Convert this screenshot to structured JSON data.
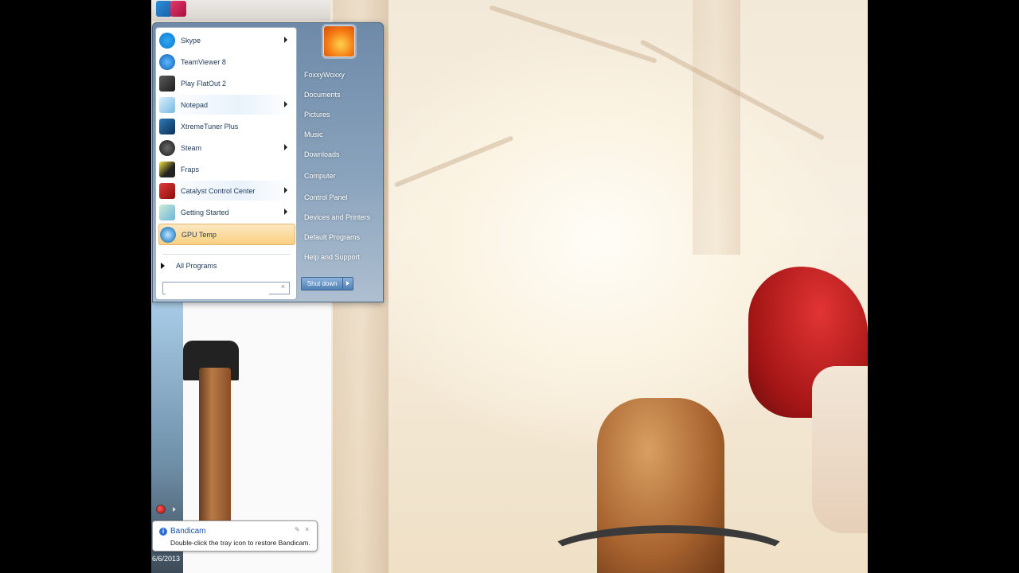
{
  "start_menu": {
    "programs": [
      {
        "label": "Skype",
        "icon": "skype-icon",
        "has_submenu": true
      },
      {
        "label": "TeamViewer 8",
        "icon": "teamviewer-icon",
        "has_submenu": false
      },
      {
        "label": "Play FlatOut 2",
        "icon": "flatout-icon",
        "has_submenu": false
      },
      {
        "label": "Notepad",
        "icon": "notepad-icon",
        "has_submenu": true
      },
      {
        "label": "XtremeTuner Plus",
        "icon": "xtremetuner-icon",
        "has_submenu": false
      },
      {
        "label": "Steam",
        "icon": "steam-icon",
        "has_submenu": true
      },
      {
        "label": "Fraps",
        "icon": "fraps-icon",
        "has_submenu": false
      },
      {
        "label": "Catalyst Control Center",
        "icon": "catalyst-icon",
        "has_submenu": true
      },
      {
        "label": "Getting Started",
        "icon": "getting-started-icon",
        "has_submenu": true
      },
      {
        "label": "GPU Temp",
        "icon": "gpu-temp-icon",
        "has_submenu": false,
        "highlighted": true
      }
    ],
    "all_programs_label": "All Programs",
    "search": {
      "value": "",
      "placeholder": ""
    },
    "places": [
      "FoxxyWoxxy",
      "Documents",
      "Pictures",
      "Music",
      "Downloads",
      "Computer",
      "Control Panel",
      "Devices and Printers",
      "Default Programs",
      "Help and Support"
    ],
    "shutdown_label": "Shut down"
  },
  "notification": {
    "title": "Bandicam",
    "message": "Double-click the tray icon to restore Bandicam.",
    "close_glyph": "×",
    "pin_glyph": "✎"
  },
  "clock": {
    "date": "6/6/2013"
  },
  "colors": {
    "highlight": "#f9cf80",
    "menu_text": "#1e395b",
    "right_pane": "#6d8aa8"
  }
}
